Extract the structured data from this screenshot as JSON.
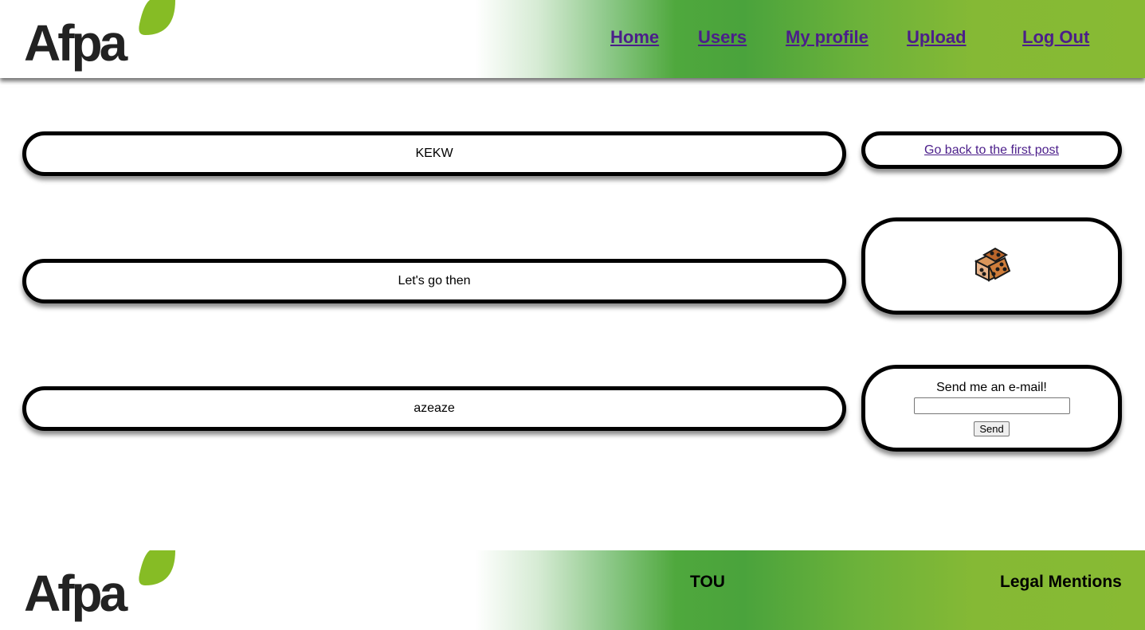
{
  "header": {
    "logo_text": "Afpa",
    "nav": [
      "Home",
      "Users",
      "My profile",
      "Upload",
      "Log Out"
    ]
  },
  "posts": [
    "KEKW",
    "Let's go then",
    "azeaze"
  ],
  "sidebar": {
    "first_post_link": "Go back to the first post",
    "image_icon": "dice-image",
    "mail_label": "Send me an e-mail!",
    "mail_value": "",
    "send_button": "Send"
  },
  "footer": {
    "logo_text": "Afpa",
    "tou": "TOU",
    "legal": "Legal Mentions"
  },
  "colors": {
    "brand_green": "#86bc25",
    "gradient_mid": "#4aa33c",
    "link_purple": "#4b1e8a"
  }
}
